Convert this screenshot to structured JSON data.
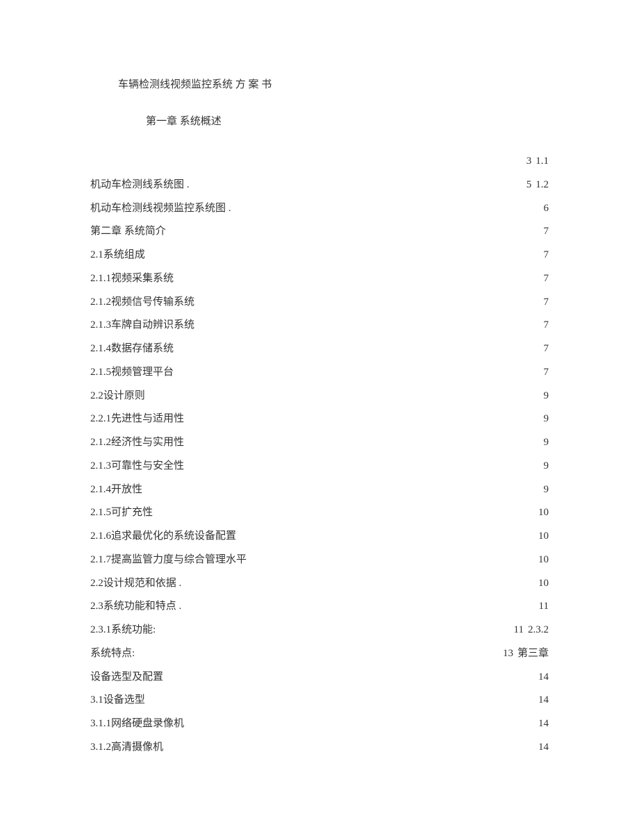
{
  "title": "车辆检测线视频监控系统 方 案 书",
  "chapter_heading": "第一章 系统概述",
  "toc": [
    {
      "label": "",
      "page": "3",
      "trail": "1.1"
    },
    {
      "label": "机动车检测线系统图 .",
      "page": "5",
      "trail": "1.2"
    },
    {
      "label": "机动车检测线视频监控系统图 .",
      "page": "6",
      "trail": ""
    },
    {
      "label": "第二章 系统简介",
      "page": "7",
      "trail": ""
    },
    {
      "label": "2.1系统组成",
      "page": "7",
      "trail": ""
    },
    {
      "label": "2.1.1视频采集系统",
      "page": "7",
      "trail": ""
    },
    {
      "label": "2.1.2视频信号传输系统",
      "page": "7",
      "trail": ""
    },
    {
      "label": "2.1.3车牌自动辨识系统",
      "page": "7",
      "trail": ""
    },
    {
      "label": "2.1.4数据存储系统",
      "page": "7",
      "trail": ""
    },
    {
      "label": "2.1.5视频管理平台",
      "page": "7",
      "trail": ""
    },
    {
      "label": "2.2设计原则",
      "page": "9",
      "trail": ""
    },
    {
      "label": "2.2.1先进性与适用性",
      "page": "9",
      "trail": ""
    },
    {
      "label": "2.1.2经济性与实用性",
      "page": "9",
      "trail": ""
    },
    {
      "label": "2.1.3可靠性与安全性",
      "page": "9",
      "trail": ""
    },
    {
      "label": "2.1.4开放性",
      "page": "9",
      "trail": ""
    },
    {
      "label": "2.1.5可扩充性",
      "page": "10",
      "trail": ""
    },
    {
      "label": "2.1.6追求最优化的系统设备配置",
      "page": "10",
      "trail": ""
    },
    {
      "label": "2.1.7提高监管力度与综合管理水平",
      "page": "10",
      "trail": ""
    },
    {
      "label": "2.2设计规范和依据 .",
      "page": "10",
      "trail": ""
    },
    {
      "label": "2.3系统功能和特点 .",
      "page": "11",
      "trail": ""
    },
    {
      "label": "2.3.1系统功能:",
      "page": "11",
      "trail": "2.3.2"
    },
    {
      "label": "系统特点:",
      "page": "13",
      "trail": "第三章"
    },
    {
      "label": "设备选型及配置",
      "page": "14",
      "trail": ""
    },
    {
      "label": "3.1设备选型",
      "page": "14",
      "trail": ""
    },
    {
      "label": "3.1.1网络硬盘录像机",
      "page": "14",
      "trail": ""
    },
    {
      "label": "3.1.2高清摄像机",
      "page": "14",
      "trail": ""
    }
  ]
}
